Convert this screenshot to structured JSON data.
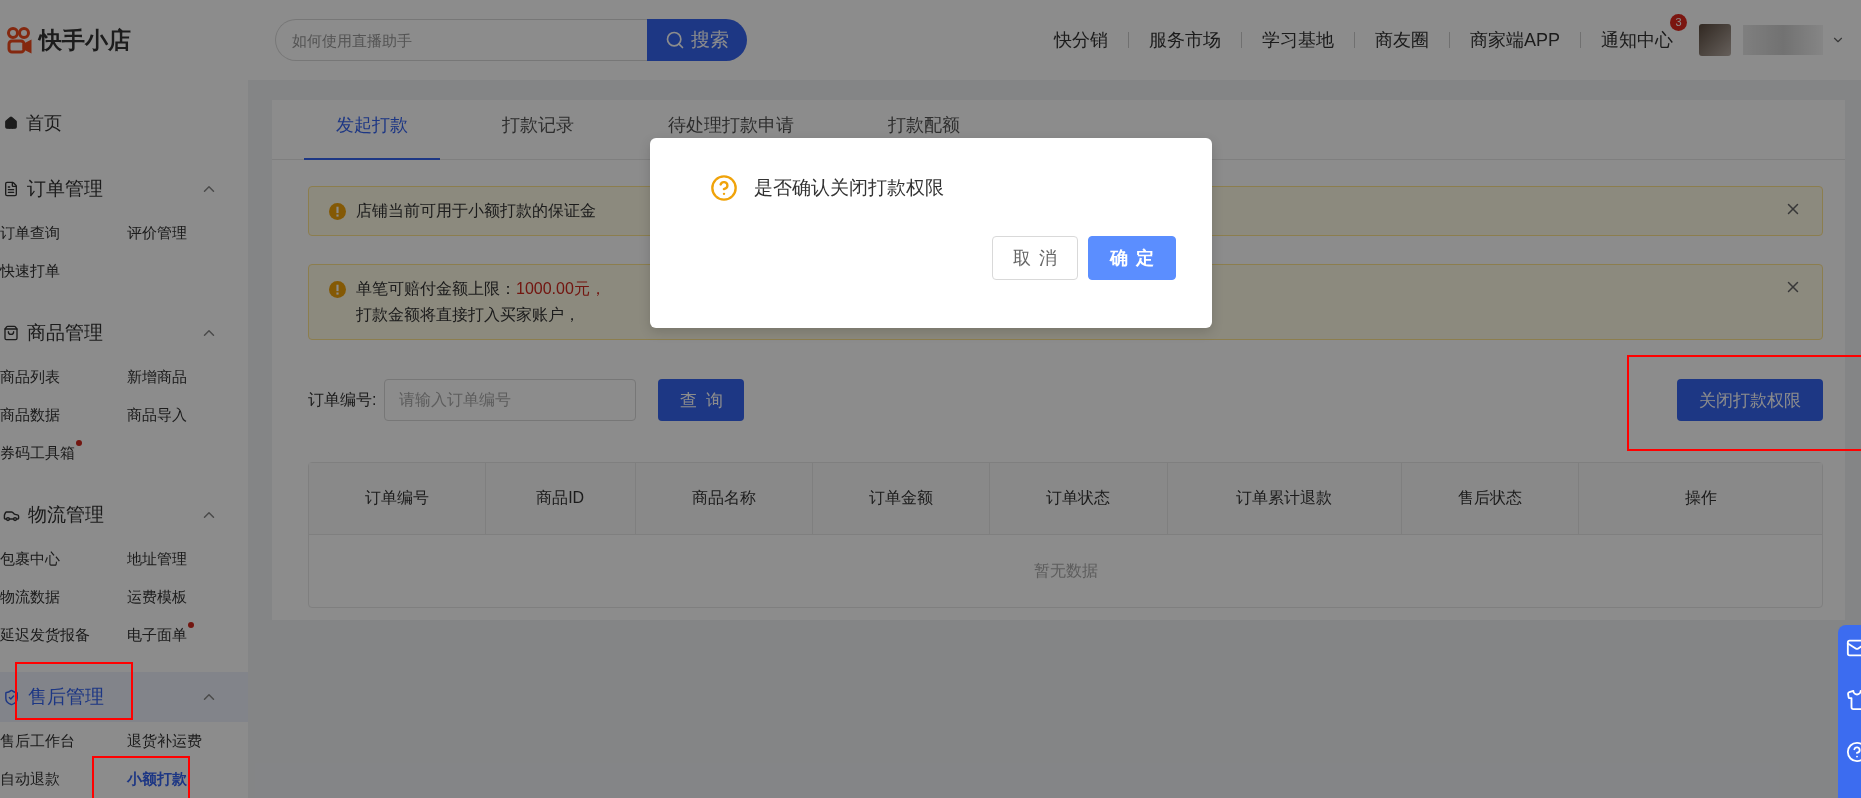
{
  "header": {
    "logo": "快手小店",
    "search": {
      "placeholder": "如何使用直播助手",
      "button": "搜索"
    },
    "nav": [
      {
        "label": "快分销"
      },
      {
        "label": "服务市场"
      },
      {
        "label": "学习基地"
      },
      {
        "label": "商友圈"
      },
      {
        "label": "商家端APP"
      },
      {
        "label": "通知中心",
        "badge": "3"
      }
    ]
  },
  "sidebar": {
    "home": "首页",
    "groups": [
      {
        "title": "订单管理",
        "kind": "order",
        "expanded": true,
        "selected": false,
        "highlighted": false,
        "items": [
          {
            "label": "订单查询",
            "selected": false,
            "dot": false,
            "highlighted": false
          },
          {
            "label": "评价管理",
            "selected": false,
            "dot": false,
            "highlighted": false
          },
          {
            "label": "快速打单",
            "selected": false,
            "dot": false,
            "highlighted": false
          }
        ]
      },
      {
        "title": "商品管理",
        "kind": "goods",
        "expanded": true,
        "selected": false,
        "highlighted": false,
        "items": [
          {
            "label": "商品列表",
            "selected": false,
            "dot": false,
            "highlighted": false
          },
          {
            "label": "新增商品",
            "selected": false,
            "dot": false,
            "highlighted": false
          },
          {
            "label": "商品数据",
            "selected": false,
            "dot": false,
            "highlighted": false
          },
          {
            "label": "商品导入",
            "selected": false,
            "dot": false,
            "highlighted": false
          },
          {
            "label": "券码工具箱",
            "selected": false,
            "dot": true,
            "highlighted": false
          }
        ]
      },
      {
        "title": "物流管理",
        "kind": "logistics",
        "expanded": true,
        "selected": false,
        "highlighted": false,
        "items": [
          {
            "label": "包裹中心",
            "selected": false,
            "dot": false,
            "highlighted": false
          },
          {
            "label": "地址管理",
            "selected": false,
            "dot": false,
            "highlighted": false
          },
          {
            "label": "物流数据",
            "selected": false,
            "dot": false,
            "highlighted": false
          },
          {
            "label": "运费模板",
            "selected": false,
            "dot": false,
            "highlighted": false
          },
          {
            "label": "延迟发货报备",
            "selected": false,
            "dot": false,
            "highlighted": false
          },
          {
            "label": "电子面单",
            "selected": false,
            "dot": true,
            "highlighted": false
          }
        ]
      },
      {
        "title": "售后管理",
        "kind": "aftersale",
        "expanded": true,
        "selected": true,
        "highlighted": true,
        "items": [
          {
            "label": "售后工作台",
            "selected": false,
            "dot": false,
            "highlighted": false
          },
          {
            "label": "退货补运费",
            "selected": false,
            "dot": false,
            "highlighted": false
          },
          {
            "label": "自动退款",
            "selected": false,
            "dot": false,
            "highlighted": false
          },
          {
            "label": "小额打款",
            "selected": true,
            "dot": false,
            "highlighted": true
          }
        ]
      }
    ]
  },
  "tabs": [
    {
      "label": "发起打款",
      "selected": true
    },
    {
      "label": "打款记录",
      "selected": false
    },
    {
      "label": "待处理打款申请",
      "selected": false
    },
    {
      "label": "打款配额",
      "selected": false
    }
  ],
  "alerts": [
    {
      "lines": [
        [
          {
            "text": "店铺当前可用于小额打款的保证金",
            "emphasis": false
          }
        ]
      ]
    },
    {
      "lines": [
        [
          {
            "text": "单笔可赔付金额上限：",
            "emphasis": false
          },
          {
            "text": "1000.00元，",
            "emphasis": true
          }
        ],
        [
          {
            "text": "打款金额将直接打入买家账户，",
            "emphasis": false
          }
        ]
      ]
    }
  ],
  "query": {
    "label": "订单编号:",
    "placeholder": "请输入订单编号",
    "button": "查询"
  },
  "close_button": {
    "label": "关闭打款权限",
    "highlighted": true
  },
  "table": {
    "columns": [
      "订单编号",
      "商品ID",
      "商品名称",
      "订单金额",
      "订单状态",
      "订单累计退款",
      "售后状态",
      "操作"
    ],
    "empty": "暂无数据"
  },
  "dialog": {
    "message": "是否确认关闭打款权限",
    "buttons": [
      {
        "label": "取消",
        "primary": false
      },
      {
        "label": "确定",
        "primary": true
      }
    ]
  }
}
